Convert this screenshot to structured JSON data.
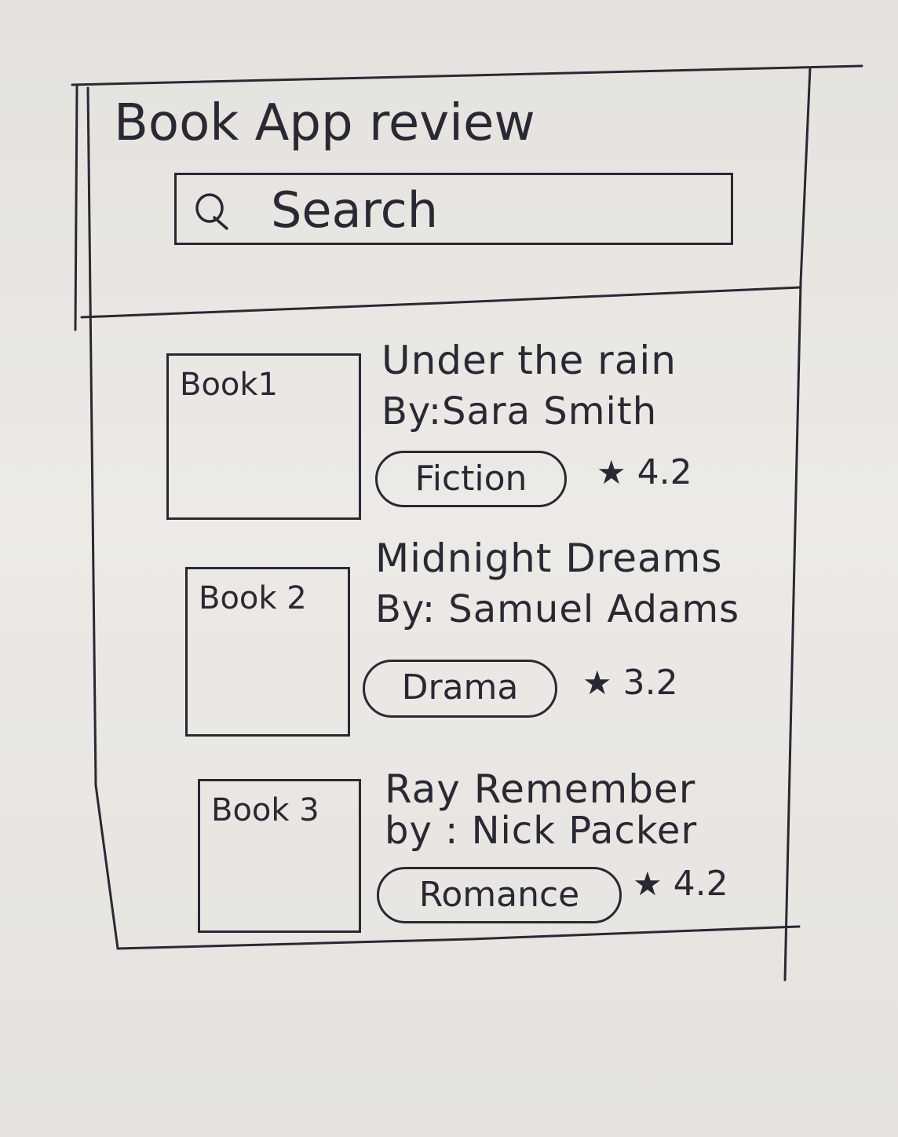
{
  "header": {
    "title": "Book App review",
    "search": {
      "icon": "search-icon",
      "placeholder": "Search"
    }
  },
  "books": [
    {
      "cover_label": "Book1",
      "title": "Under the rain",
      "author": "By:Sara Smith",
      "genre": "Fiction",
      "rating_icon": "star-icon",
      "rating": "4.2"
    },
    {
      "cover_label": "Book 2",
      "title": "Midnight Dreams",
      "author": "By: Samuel Adams",
      "genre": "Drama",
      "rating_icon": "star-icon",
      "rating": "3.2"
    },
    {
      "cover_label": "Book 3",
      "title": "Ray Remember",
      "author": "by : Nick Packer",
      "genre": "Romance",
      "rating_icon": "star-icon",
      "rating": "4.2"
    }
  ],
  "colors": {
    "paper": "#e7e6e2",
    "ink": "#2a2833"
  }
}
